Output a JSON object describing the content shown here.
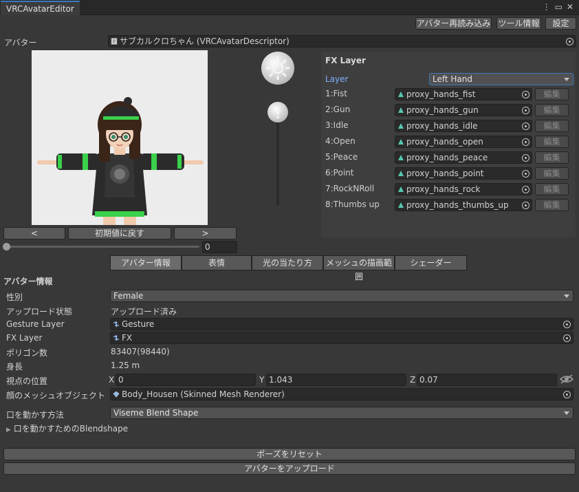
{
  "window": {
    "tab_title": "VRCAvatarEditor"
  },
  "toolbar": {
    "reload_label": "アバター再読み込み",
    "tool_info_label": "ツール情報",
    "settings_label": "設定"
  },
  "avatar_field": {
    "label": "アバター",
    "value": "サブカルクロちゃん (VRCAvatarDescriptor)"
  },
  "preview": {
    "prev_label": "<",
    "reset_label": "初期値に戻す",
    "next_label": ">",
    "slider_value": "0"
  },
  "fx": {
    "title": "FX Layer",
    "layer_label": "Layer",
    "layer_value": "Left Hand",
    "edit_label": "編集",
    "rows": [
      {
        "label": "1:Fist",
        "value": "proxy_hands_fist"
      },
      {
        "label": "2:Gun",
        "value": "proxy_hands_gun"
      },
      {
        "label": "3:Idle",
        "value": "proxy_hands_idle"
      },
      {
        "label": "4:Open",
        "value": "proxy_hands_open"
      },
      {
        "label": "5:Peace",
        "value": "proxy_hands_peace"
      },
      {
        "label": "6:Point",
        "value": "proxy_hands_point"
      },
      {
        "label": "7:RockNRoll",
        "value": "proxy_hands_rock"
      },
      {
        "label": "8:Thumbs up",
        "value": "proxy_hands_thumbs_up"
      }
    ]
  },
  "tabs": [
    "アバター情報",
    "表情",
    "光の当たり方",
    "メッシュの描画範囲",
    "シェーダー"
  ],
  "info": {
    "section_title": "アバター情報",
    "gender_label": "性別",
    "gender_value": "Female",
    "upload_label": "アップロード状態",
    "upload_value": "アップロード済み",
    "gesture_label": "Gesture Layer",
    "gesture_value": "Gesture",
    "fxlayer_label": "FX Layer",
    "fxlayer_value": "FX",
    "polygon_label": "ポリゴン数",
    "polygon_value": "83407(98440)",
    "height_label": "身長",
    "height_value": "1.25 m",
    "viewpoint_label": "視点の位置",
    "vp_x_label": "X",
    "vp_x": "0",
    "vp_y_label": "Y",
    "vp_y": "1.043",
    "vp_z_label": "Z",
    "vp_z": "0.07",
    "face_mesh_label": "顔のメッシュオブジェクト",
    "face_mesh_value": "Body_Housen (Skinned Mesh Renderer)",
    "lipsync_label": "口を動かす方法",
    "lipsync_value": "Viseme Blend Shape",
    "blendshape_foldout": "口を動かすためのBlendshape"
  },
  "footer": {
    "reset_pose_label": "ポーズをリセット",
    "upload_label": "アバターをアップロード"
  },
  "colors": {
    "accent": "#3a79bb",
    "background": "#383838",
    "field": "#2a2a2a",
    "layer_label": "#7fb0ff"
  }
}
